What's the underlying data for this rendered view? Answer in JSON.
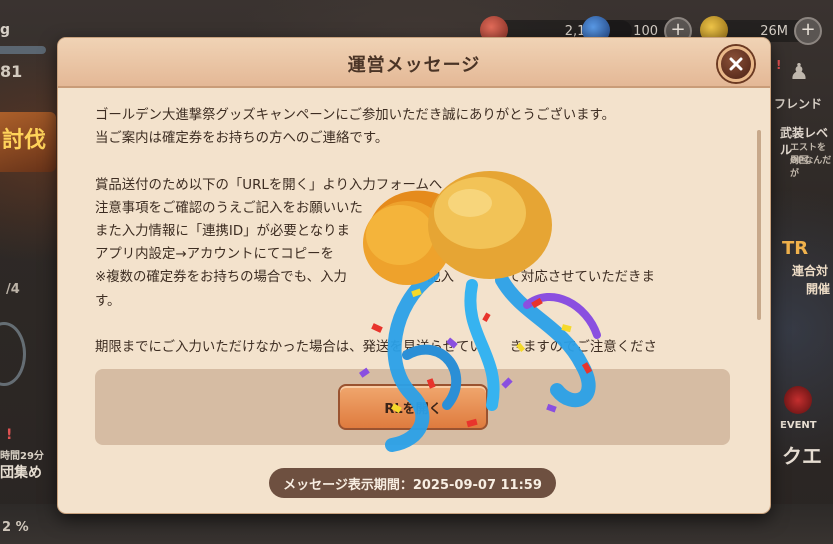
{
  "background": {
    "player_name_fragment": "g",
    "player_stat_fragment": "81",
    "banner_fragment": "討伐",
    "page_indicator": "/4",
    "timer_text": "時間29分",
    "collect_label": "団集め",
    "percent_text": "2 %",
    "resources": [
      {
        "icon": "ruby-icon",
        "value": "2,185"
      },
      {
        "icon": "crystal-icon",
        "value": "100"
      },
      {
        "icon": "gold-coin-icon",
        "value": "26M"
      }
    ],
    "friend_label": "フレンド",
    "equip_level_label": "武装レベル",
    "side_hint_1": "エストを周回",
    "side_hint_2": "OPなんだが",
    "campaign_fragment_1": "TR",
    "campaign_fragment_2": "連合対",
    "campaign_fragment_3": "開催",
    "event_label": "EVENT",
    "quest_label": "クエ"
  },
  "dialog": {
    "title": "運営メッセージ",
    "close_icon": "close-icon",
    "message_lines": [
      "ゴールデン大進撃祭グッズキャンペーンにご参加いただき誠にありがとうございます。",
      "当ご案内は確定券をお持ちの方へのご連絡です。",
      "",
      "賞品送付のため以下の「URLを開く」より入力フォームへ　　いただき、",
      "注意事項をご確認のうえご記入をお願いいた",
      "また入力情報に「連携ID」が必要となりま",
      "アプリ内設定→アカウントにてコピーを",
      "※複数の確定券をお持ちの場合でも、入力　　　　　　記入　　　　て対応させていただきま",
      "す。",
      "",
      "期限までにご入力いただけなかった場合は、発送を見送らせてい　　きますのでご注意くださ"
    ],
    "url_button_label": "RLを開く",
    "display_period": "メッセージ表示期間：2025-09-07 11:59"
  },
  "overlay": {
    "icon": "party-cracker-icon",
    "colors": {
      "ribbon": "#2aa0e8",
      "ball": "#f0b63c",
      "confetti_red": "#e8342c",
      "confetti_purple": "#8a4fe0",
      "confetti_yellow": "#f5d92a"
    }
  }
}
